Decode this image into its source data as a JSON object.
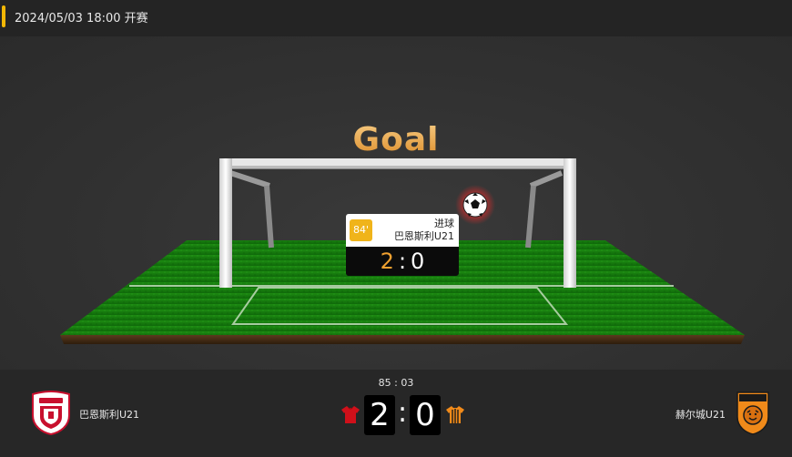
{
  "header": {
    "datetime": "2024/05/03 18:00 开赛",
    "accent_color": "#f2b705"
  },
  "stage": {
    "title": "Goal",
    "ball_icon": "football-icon"
  },
  "event_popup": {
    "minute": "84'",
    "event_type": "进球",
    "team": "巴恩斯利U21",
    "score_home": "2",
    "score_separator": ":",
    "score_away": "0"
  },
  "match": {
    "clock": "85 : 03",
    "home": {
      "name": "巴恩斯利U21",
      "crest_icon": "barnsley-crest-icon",
      "kit_color": "#d0101a",
      "score": "2"
    },
    "away": {
      "name": "赫尔城U21",
      "crest_icon": "hull-city-crest-icon",
      "kit_color": "#f08a1a",
      "score": "0"
    },
    "score_separator": ":"
  }
}
